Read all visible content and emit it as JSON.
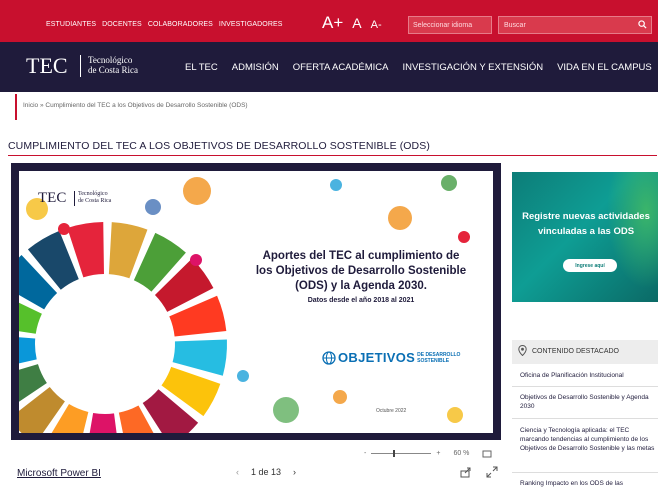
{
  "top_links": [
    "ESTUDIANTES",
    "DOCENTES",
    "COLABORADORES",
    "INVESTIGADORES"
  ],
  "font_size_controls": [
    "A+",
    "A",
    "A-"
  ],
  "language_select": "Seleccionar idioma",
  "search_placeholder": "Buscar",
  "logo": {
    "abbr": "TEC",
    "line1": "Tecnológico",
    "line2": "de Costa Rica"
  },
  "nav": [
    "EL TEC",
    "ADMISIÓN",
    "OFERTA ACADÉMICA",
    "INVESTIGACIÓN Y EXTENSIÓN",
    "VIDA EN EL CAMPUS"
  ],
  "breadcrumb": "Inicio » Cumplimiento del TEC a los Objetivos de Desarrollo Sostenible (ODS)",
  "page_title": "CUMPLIMIENTO DEL TEC A LOS OBJETIVOS DE DESARROLLO SOSTENIBLE (ODS)",
  "slide": {
    "logo_abbr": "TEC",
    "logo_line1": "Tecnológico",
    "logo_line2": "de Costa Rica",
    "heading_line1": "Aportes del TEC al cumplimiento de",
    "heading_line2": "los Objetivos de Desarrollo Sostenible",
    "heading_line3": "(ODS) y la Agenda 2030.",
    "subheading": "Datos desde el año 2018 al 2021",
    "ods_word": "OBJETIVOS",
    "ods_sub1": "DE DESARROLLO",
    "ods_sub2": "SOSTENIBLE",
    "date": "Octubre 2022",
    "wheel_colors": [
      "#e5243b",
      "#dda63a",
      "#4c9f38",
      "#c5192d",
      "#ff3a21",
      "#26bde2",
      "#fcc30b",
      "#a21942",
      "#fd6925",
      "#dd1367",
      "#fd9d24",
      "#bf8b2e",
      "#3f7e44",
      "#0a97d9",
      "#56c02b",
      "#00689d",
      "#19486a"
    ]
  },
  "report_controls": {
    "zoom_minus": "-",
    "zoom_plus": "+",
    "zoom_level": "60 %",
    "powerbi_link": "Microsoft Power BI",
    "prev": "‹",
    "page": "1 de 13",
    "next": "›"
  },
  "banner": {
    "line1": "Registre nuevas actividades",
    "line2": "vinculadas a las ODS",
    "button": "Ingrese aquí"
  },
  "featured": {
    "title": "CONTENIDO DESTACADO",
    "items": [
      "Oficina de Planificación Institucional",
      "Objetivos de Desarrollo Sostenible y Agenda 2030",
      "Ciencia y Tecnología aplicada: el TEC marcando tendencias al cumplimiento de los Objetivos de Desarrollo Sostenible y las metas",
      "Ranking Impacto en los ODS de las"
    ]
  }
}
